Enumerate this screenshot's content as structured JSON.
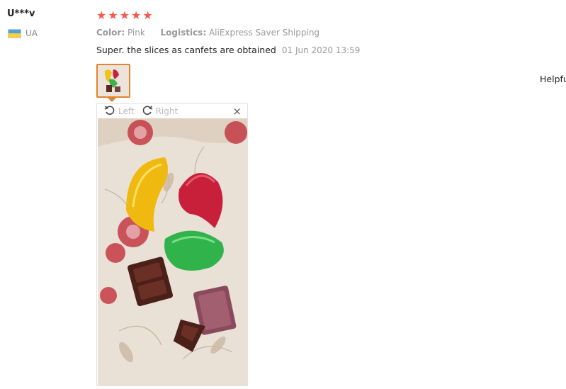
{
  "review": {
    "user": "U***v",
    "country": "UA",
    "rating_stars": 5,
    "meta": {
      "color_label": "Color:",
      "color_value": "Pink",
      "logistics_label": "Logistics:",
      "logistics_value": "AliExpress Saver Shipping"
    },
    "text": "Super. the slices as canfets are obtained",
    "date": "01 Jun 2020 13:59",
    "helpful_label": "Helpfu"
  },
  "viewer": {
    "rotate_left": "Left",
    "rotate_right": "Right",
    "close": "×"
  },
  "colors": {
    "star": "#f4594b",
    "thumb_border": "#e0842f"
  },
  "icons": {
    "rotate_left": "rotate-left-icon",
    "rotate_right": "rotate-right-icon",
    "close": "close-icon",
    "flag": "ukraine-flag-icon",
    "star": "star-icon"
  }
}
